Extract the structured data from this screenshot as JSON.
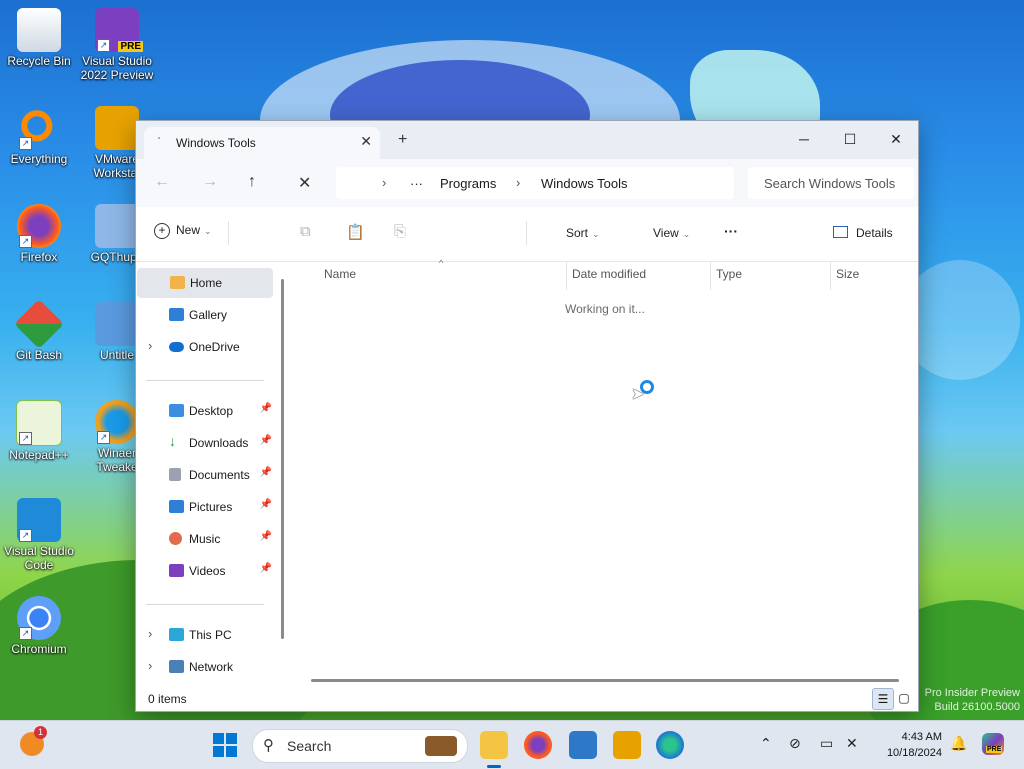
{
  "desktop": {
    "icons": [
      {
        "label": "Recycle Bin",
        "color": "#ffffff"
      },
      {
        "label": "Visual Studio 2022 Preview",
        "badge": "PRE",
        "color": "#7b3fbf"
      },
      {
        "label": "Everything",
        "color": "#ff8a00"
      },
      {
        "label": "VMware Workstat",
        "color": "#e8a200"
      },
      {
        "label": "Firefox",
        "color": "#ff5a1f"
      },
      {
        "label": "GQThupp",
        "color": "#8fb8e8"
      },
      {
        "label": "Git Bash",
        "color": "#e74c3c"
      },
      {
        "label": "Untitle",
        "color": "#5a9be0"
      },
      {
        "label": "Notepad++",
        "color": "#7fc04a"
      },
      {
        "label": "Winaer Tweake",
        "color": "#f0a020"
      },
      {
        "label": "Visual Studio Code",
        "color": "#1f8ad8"
      },
      {
        "label": "Chromium",
        "color": "#3b82f6"
      }
    ],
    "watermark": [
      "Pro Insider Preview",
      "Build 26100.5000"
    ]
  },
  "explorer": {
    "tab_title": "Windows Tools",
    "new_tab_icon": "+",
    "controls": {
      "minimize": "─",
      "maximize": "☐",
      "close": "✕"
    },
    "breadcrumb": {
      "more": "···",
      "items": [
        "Programs",
        "Windows Tools"
      ]
    },
    "search_placeholder": "Search Windows Tools",
    "toolbar": {
      "new_label": "New",
      "sort_label": "Sort",
      "view_label": "View",
      "more_label": "···",
      "details_label": "Details"
    },
    "nav": {
      "top": [
        {
          "label": "Home",
          "icon": "home-icon",
          "selected": true
        },
        {
          "label": "Gallery",
          "icon": "gallery-icon"
        },
        {
          "label": "OneDrive",
          "icon": "cloud-icon",
          "expandable": true
        }
      ],
      "quick": [
        {
          "label": "Desktop",
          "icon": "desktop-icon",
          "pinned": true
        },
        {
          "label": "Downloads",
          "icon": "download-icon",
          "pinned": true
        },
        {
          "label": "Documents",
          "icon": "document-icon",
          "pinned": true
        },
        {
          "label": "Pictures",
          "icon": "picture-icon",
          "pinned": true
        },
        {
          "label": "Music",
          "icon": "music-icon",
          "pinned": true
        },
        {
          "label": "Videos",
          "icon": "video-icon",
          "pinned": true
        }
      ],
      "bottom": [
        {
          "label": "This PC",
          "icon": "computer-icon",
          "expandable": true
        },
        {
          "label": "Network",
          "icon": "network-icon",
          "expandable": true
        }
      ]
    },
    "columns": [
      "Name",
      "Date modified",
      "Type",
      "Size"
    ],
    "status_message": "Working on it...",
    "item_count": "0 items"
  },
  "taskbar": {
    "search_label": "Search",
    "notification_count": "1",
    "time": "4:43 AM",
    "date": "10/18/2024",
    "copilot_badge": "PRE"
  }
}
